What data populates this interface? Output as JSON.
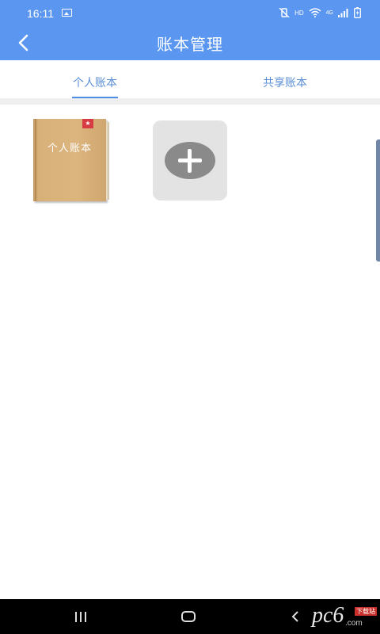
{
  "status_bar": {
    "time": "16:11",
    "image_icon": "image-icon",
    "mute_icon": "vibrate-mute-icon",
    "hd_label": "HD",
    "wifi_icon": "wifi-icon",
    "network_label": "4G",
    "signal_icon": "signal-bars-icon",
    "battery_icon": "battery-charging-icon"
  },
  "header": {
    "title": "账本管理",
    "back_icon": "chevron-left-icon",
    "background_color": "#5b97f0"
  },
  "tabs": [
    {
      "label": "个人账本",
      "selected": true
    },
    {
      "label": "共享账本",
      "selected": false
    }
  ],
  "accent_color": "#4f8ce6",
  "ledgers": [
    {
      "title": "个人账本",
      "cover_icon": "book-icon",
      "badge_icon": "star-icon",
      "badge_color": "#d63b43"
    }
  ],
  "add_ledger": {
    "icon": "plus-icon"
  },
  "nav_bar": {
    "recent_icon": "recent-apps-icon",
    "home_icon": "home-icon",
    "back_icon": "back-icon"
  },
  "watermark": {
    "brand": "pc6",
    "domain": ".com",
    "tag": "下载站"
  }
}
